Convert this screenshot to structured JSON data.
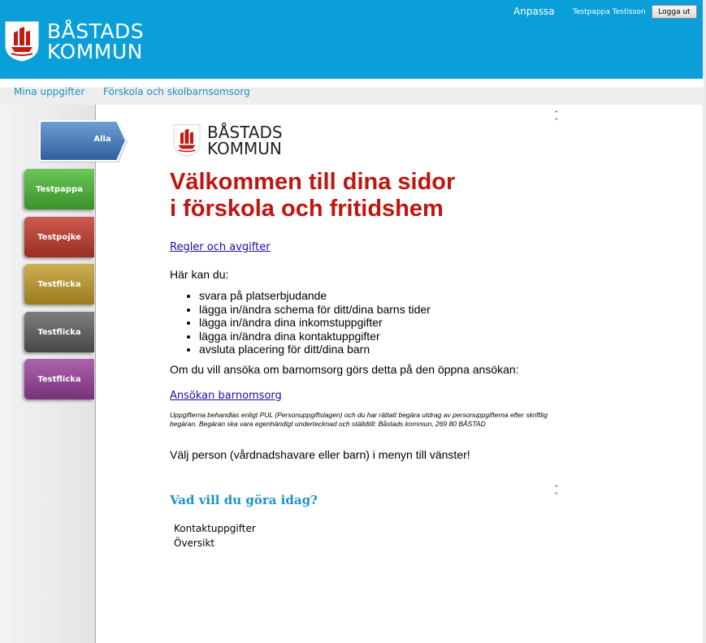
{
  "header": {
    "logo_line1": "BÅSTADS",
    "logo_line2": "KOMMUN",
    "anpassa": "Anpassa",
    "user_name": "Testpappa Testisson",
    "logout_label": "Logga ut"
  },
  "nav": {
    "items": [
      {
        "label": "Mina uppgifter"
      },
      {
        "label": "Förskola och skolbarnsomsorg"
      }
    ]
  },
  "sidebar": {
    "tabs": [
      {
        "label": "Alla",
        "color": "#3e74b3"
      },
      {
        "label": "Testpappa",
        "color": "#45a833"
      },
      {
        "label": "Testpojke",
        "color": "#b03c30"
      },
      {
        "label": "Testflicka",
        "color": "#b1912c"
      },
      {
        "label": "Testflicka",
        "color": "#5c5c5c"
      },
      {
        "label": "Testflicka",
        "color": "#8c3f8e"
      }
    ]
  },
  "content": {
    "logo_line1": "BÅSTADS",
    "logo_line2": "KOMMUN",
    "title_line1": "Välkommen till dina sidor",
    "title_line2": "i förskola och fritidshem",
    "rules_link": "Regler och avgifter",
    "intro": "Här kan du:",
    "bullets": [
      "svara på platserbjudande",
      "lägga in/ändra schema för ditt/dina barns tider",
      "lägga in/ändra dina inkomstuppgifter",
      "lägga in/ändra dina kontaktuppgifter",
      "avsluta placering för ditt/dina barn"
    ],
    "apply_text": "Om du vill ansöka om barnomsorg görs detta på den öppna ansökan:",
    "apply_link": "Ansökan barnomsorg",
    "legal_text": "Uppgifterna behandlas enligt PUL (Personuppgiftslagen) och du har rättatt begära utdrag av personuppgifterna efter skriftlig begäran. Begäran ska vara egenhändigt undertecknad och ställdtill: Båstads kommun, 269 80 BÅSTAD",
    "choose_person": "Välj person (vårdnadshavare eller barn) i menyn till vänster!",
    "section_title": "Vad vill du göra idag?",
    "actions": [
      {
        "label": "Kontaktuppgifter"
      },
      {
        "label": "Översikt"
      }
    ],
    "collapse_icon": "double-chevron-up-icon"
  },
  "colors": {
    "header_bg": "#0a9fd8",
    "title": "#c0150f",
    "nav_link": "#1e8fc0"
  }
}
